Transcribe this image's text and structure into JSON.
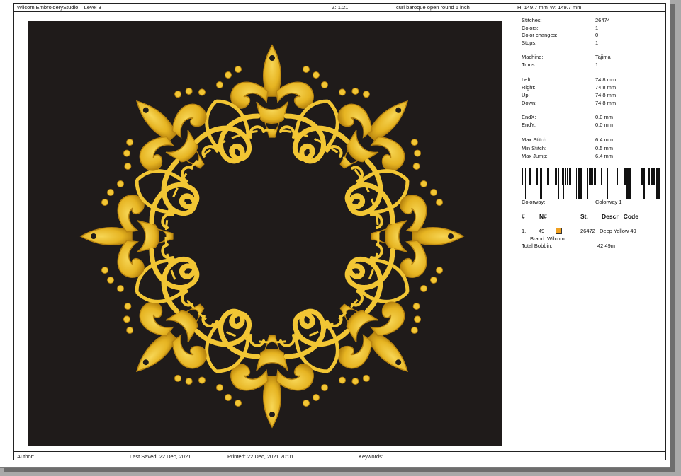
{
  "header": {
    "app_title": "Wilcom EmbroideryStudio – Level 3",
    "zoom": "Z: 1.21",
    "design_name": "curl baroque open round 6  inch",
    "height": "H: 149.7 mm",
    "width": "W: 149.7 mm"
  },
  "stats": [
    {
      "label": "Stitches:",
      "value": "26474"
    },
    {
      "label": "Colors:",
      "value": "1"
    },
    {
      "label": "Color changes:",
      "value": "0"
    },
    {
      "label": "Stops:",
      "value": "1"
    },
    {
      "label": "Machine:",
      "value": "Tajima"
    },
    {
      "label": "Trims:",
      "value": "1"
    },
    {
      "label": "Left:",
      "value": "74.8 mm"
    },
    {
      "label": "Right:",
      "value": "74.8 mm"
    },
    {
      "label": "Up:",
      "value": "74.8 mm"
    },
    {
      "label": "Down:",
      "value": "74.8 mm"
    },
    {
      "label": "EndX:",
      "value": "0.0 mm"
    },
    {
      "label": "EndY:",
      "value": "0.0 mm"
    },
    {
      "label": "Max Stitch:",
      "value": "6.4 mm"
    },
    {
      "label": "Min Stitch:",
      "value": "0.5 mm"
    },
    {
      "label": "Max Jump:",
      "value": "6.4 mm"
    }
  ],
  "colorway": {
    "label": "Colorway:",
    "value": "Colorway 1"
  },
  "thread_table": {
    "headers": {
      "num": "#",
      "code": "N#",
      "stitches": "St.",
      "descr": "Descr _Code"
    },
    "rows": [
      {
        "index": "1.",
        "code": "49",
        "color": "#f0a020",
        "stitches": "26472",
        "descr": "Deep Yellow 49",
        "brand": "Brand: Wilcom"
      }
    ],
    "bobbin_label": "Total Bobbin:",
    "bobbin_value": "42.49m"
  },
  "footer": {
    "author_label": "Author:",
    "last_saved": "Last Saved: 22 Dec, 2021",
    "printed": "Printed: 22 Dec, 2021 20:01",
    "keywords_label": "Keywords:"
  },
  "colors": {
    "canvas_bg": "#1f1b1a",
    "gold_light": "#f2c634",
    "gold_dark": "#b88410"
  }
}
